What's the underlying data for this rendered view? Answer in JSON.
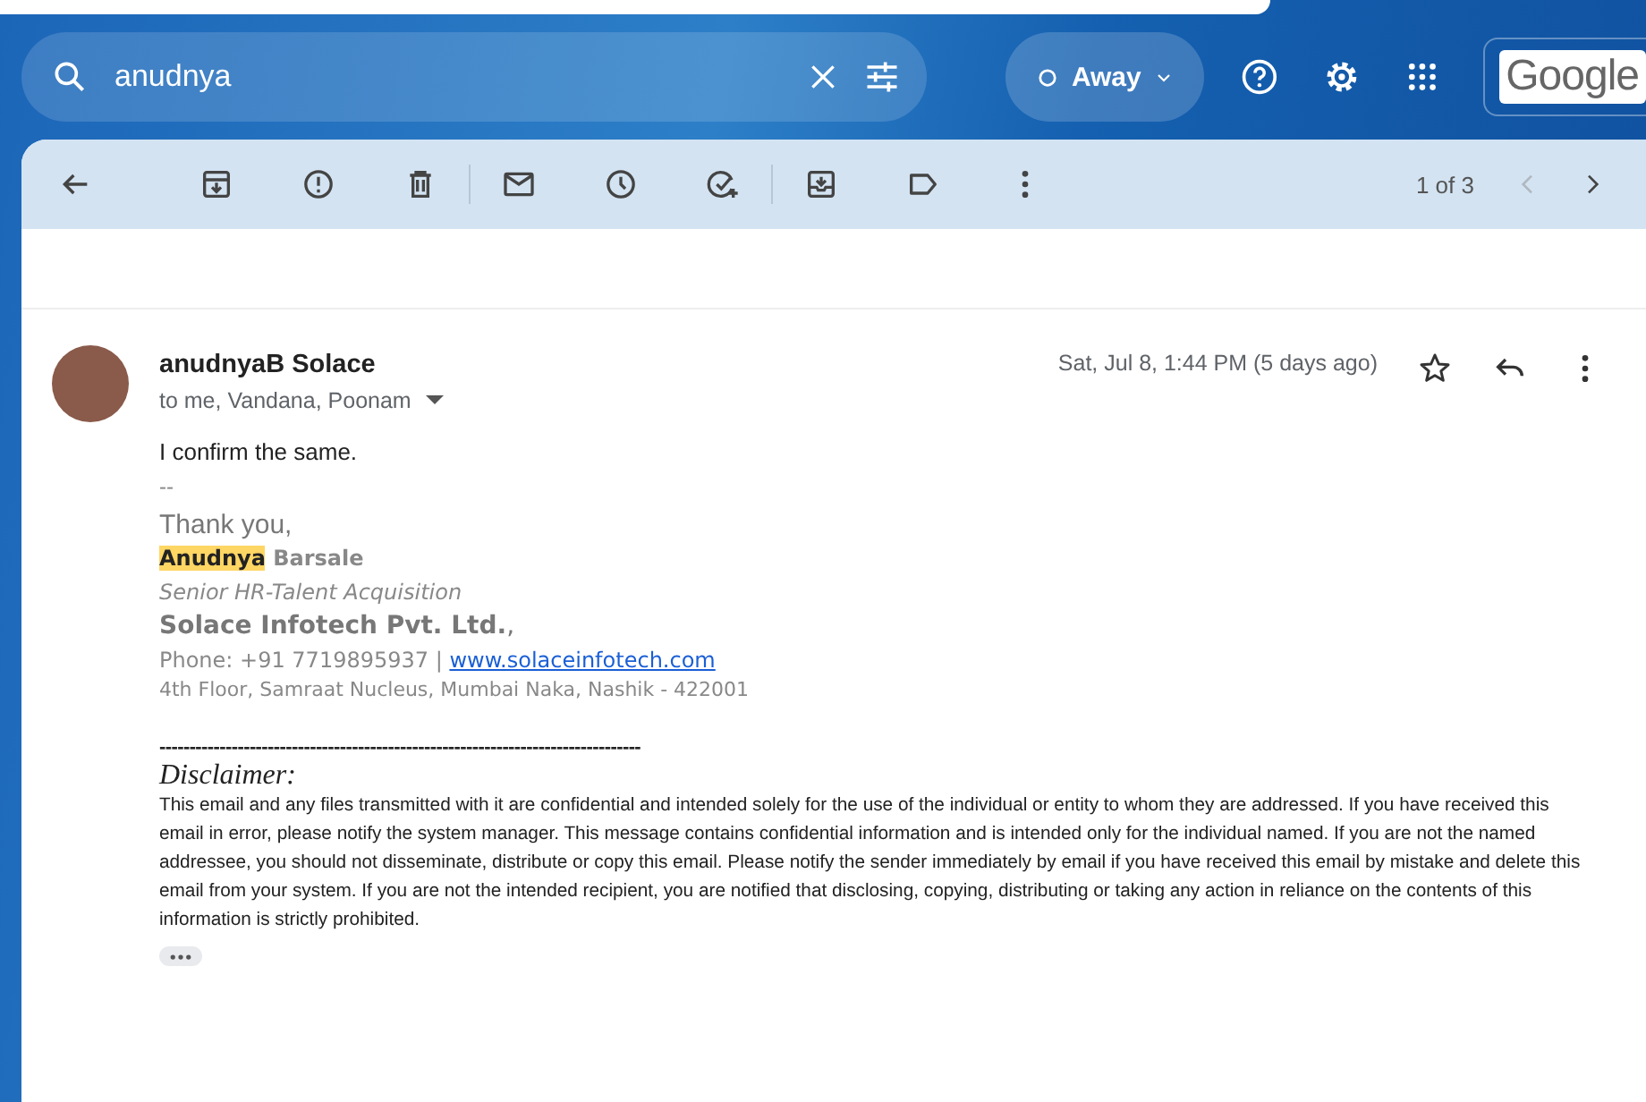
{
  "search": {
    "value": "anudnya"
  },
  "status": {
    "label": "Away"
  },
  "logo": {
    "text": "Google"
  },
  "toolbar": {
    "pager": "1 of 3"
  },
  "message": {
    "sender": "anudnyaB Solace",
    "recipients": "to me, Vandana, Poonam",
    "date": "Sat, Jul 8, 1:44 PM (5 days ago)",
    "starred": false,
    "body": "I confirm the same.",
    "separator": "--",
    "signature": {
      "closing": "Thank you,",
      "name": [
        {
          "text": "Anudnya",
          "highlighted": true
        },
        {
          "text": "Barsale",
          "highlighted": false
        }
      ],
      "title": "Senior HR-Talent Acquisition",
      "company": "Solace Infotech Pvt. Ltd.",
      "company_suffix": ",",
      "phone": "Phone: +91 7719895937 |",
      "website": "www.solaceinfotech.com",
      "address": "4th Floor, Samraat Nucleus, Mumbai Naka, Nashik - 422001"
    },
    "rule": "--------------------------------------------------------------------------------",
    "disclaimer_title": "Disclaimer:",
    "disclaimer": "This email and any files transmitted with it are confidential and intended solely for the use of the individual or entity to whom they are addressed. If you have received this email in error, please notify the system manager. This message contains confidential information and is intended only for the individual named. If you are not the named addressee, you should not disseminate, distribute or copy this email. Please notify the sender immediately by email if you have received this email by mistake and delete this email from your system. If you are not the intended recipient, you are notified that disclosing, copying, distributing or taking any action in reliance on the contents of this information is strictly prohibited."
  }
}
